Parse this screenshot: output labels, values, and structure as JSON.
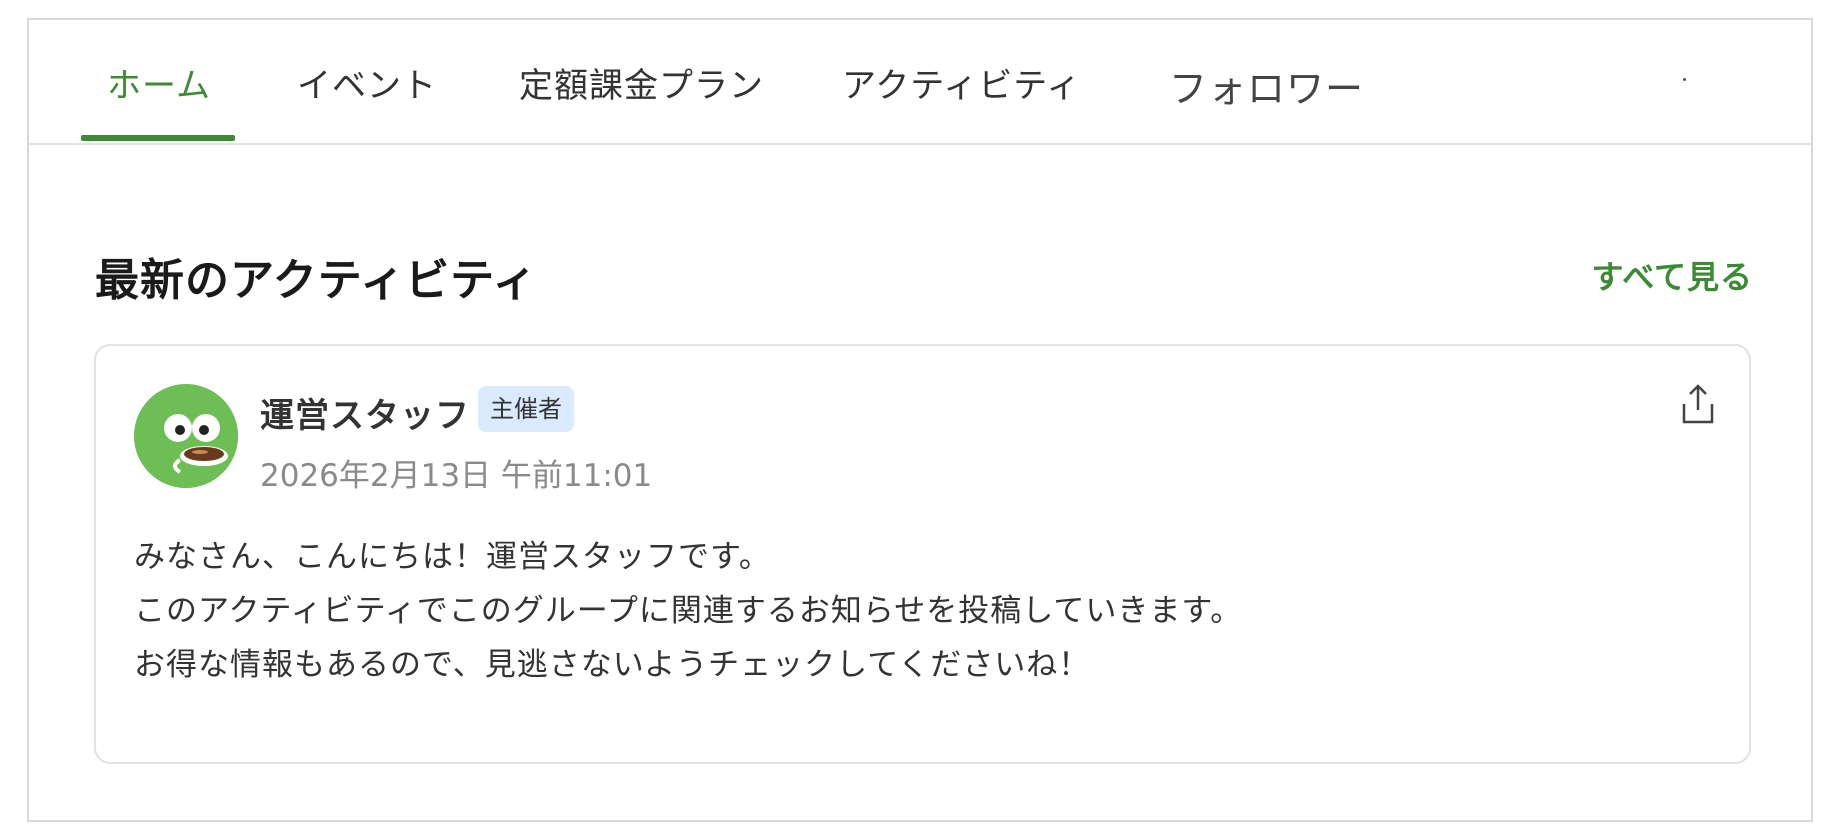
{
  "tabs": [
    {
      "label": "ホーム",
      "active": true
    },
    {
      "label": "イベント",
      "active": false
    },
    {
      "label": "定額課金プラン",
      "active": false
    },
    {
      "label": "アクティビティ",
      "active": false
    },
    {
      "label": "フォロワー",
      "active": false
    }
  ],
  "section": {
    "title": "最新のアクティビティ",
    "see_all": "すべて見る"
  },
  "post": {
    "author": "運営スタッフ",
    "badge": "主催者",
    "timestamp": "2026年2月13日 午前11:01",
    "lines": [
      "みなさん、こんにちは！運営スタッフです。",
      "このアクティビティでこのグループに関連するお知らせを投稿していきます。",
      "お得な情報もあるので、見逃さないようチェックしてくださいね！"
    ],
    "share_icon": "share-icon"
  },
  "colors": {
    "accent": "#3c8a34",
    "badge_bg": "#dceaff",
    "avatar_bg": "#6dbf55"
  }
}
